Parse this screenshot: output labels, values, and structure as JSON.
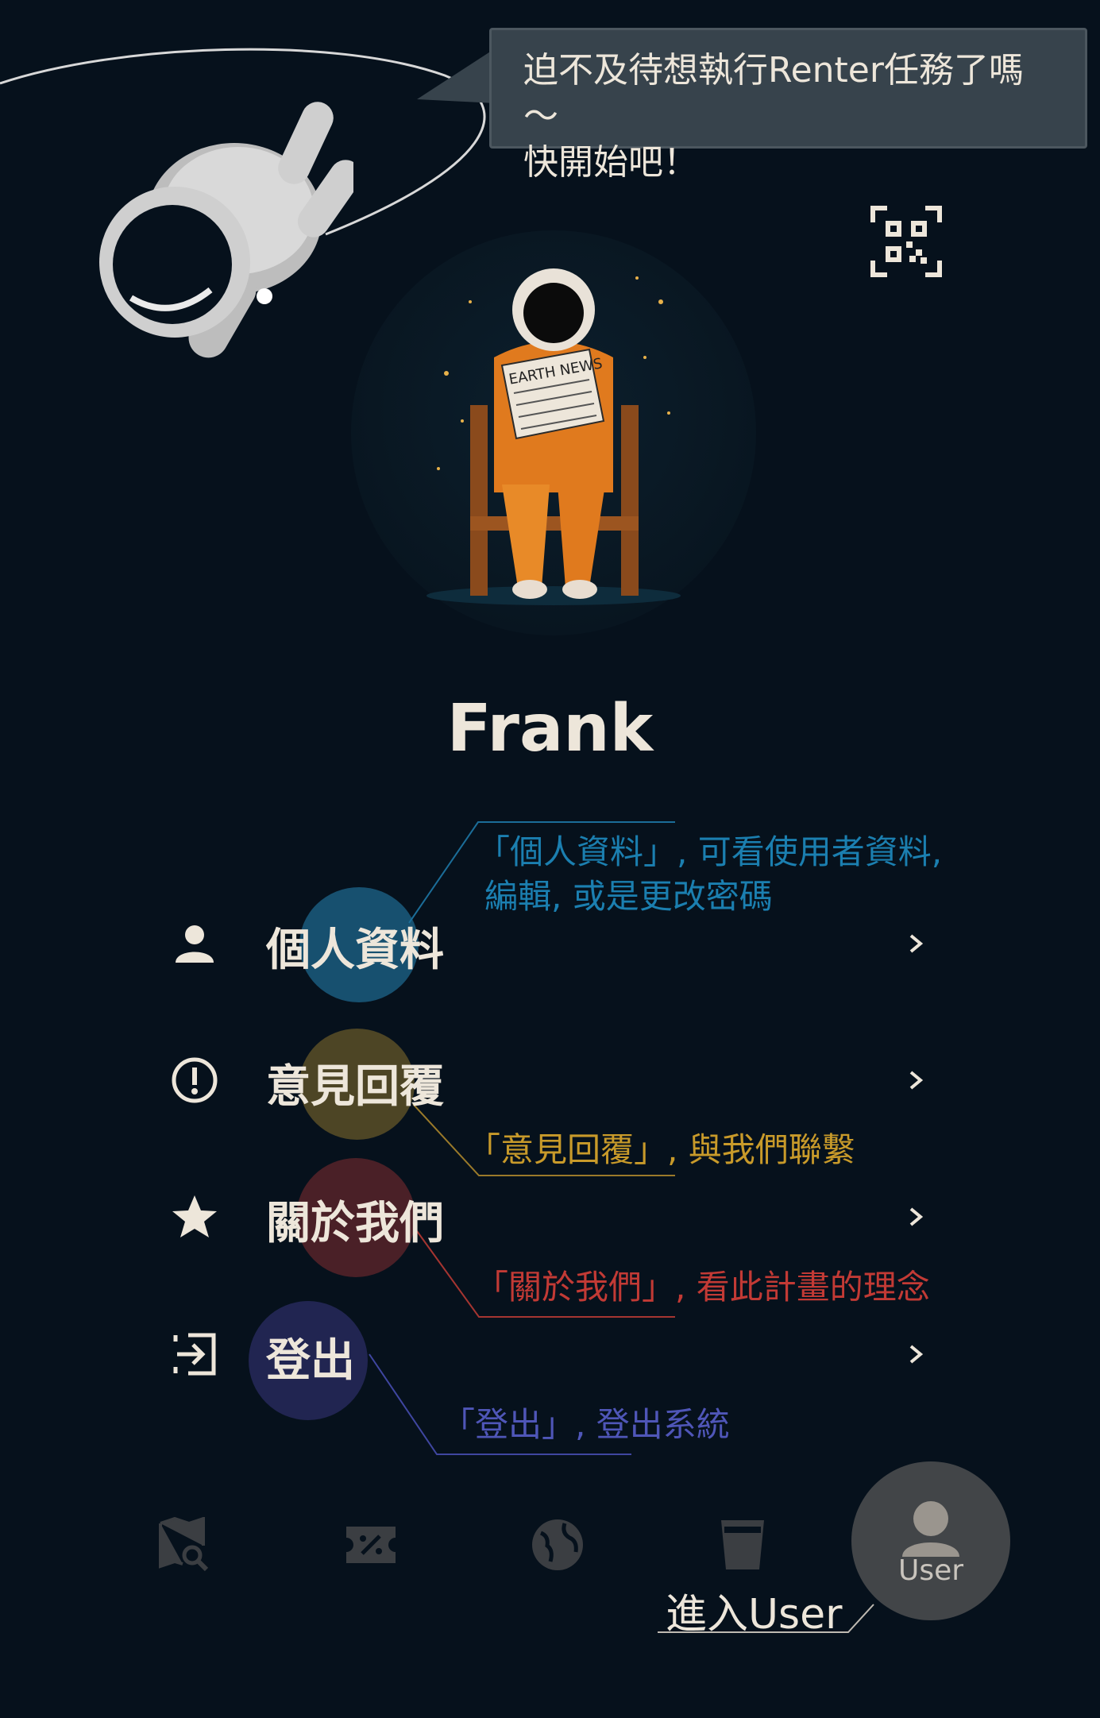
{
  "bubble": {
    "line1": "迫不及待想執行Renter任務了嗎～",
    "line2": "快開始吧！"
  },
  "profile": {
    "name": "Frank",
    "avatar_text": "EARTH NEWS"
  },
  "menu": [
    {
      "label": "個人資料",
      "icon": "person-icon"
    },
    {
      "label": "意見回覆",
      "icon": "alert-circle-icon"
    },
    {
      "label": "關於我們",
      "icon": "star-icon"
    },
    {
      "label": "登出",
      "icon": "logout-icon"
    }
  ],
  "callouts": {
    "profile_line1": "「個人資料」, 可看使用者資料,",
    "profile_line2": "編輯, 或是更改密碼",
    "feedback": "「意見回覆」, 與我們聯繫",
    "about": "「關於我們」, 看此計畫的理念",
    "logout": "「登出」, 登出系統"
  },
  "colors": {
    "background": "#06111c",
    "profile_callout": "#1b7fb0",
    "feedback_callout": "#c89a2a",
    "about_callout": "#c23a35",
    "logout_callout": "#4f56b8"
  },
  "bottom_nav": {
    "items": [
      "map-search-icon",
      "coupon-icon",
      "globe-icon",
      "cup-icon",
      "user-icon"
    ],
    "active_label": "User"
  },
  "annotation": {
    "enter_user": "進入User"
  }
}
